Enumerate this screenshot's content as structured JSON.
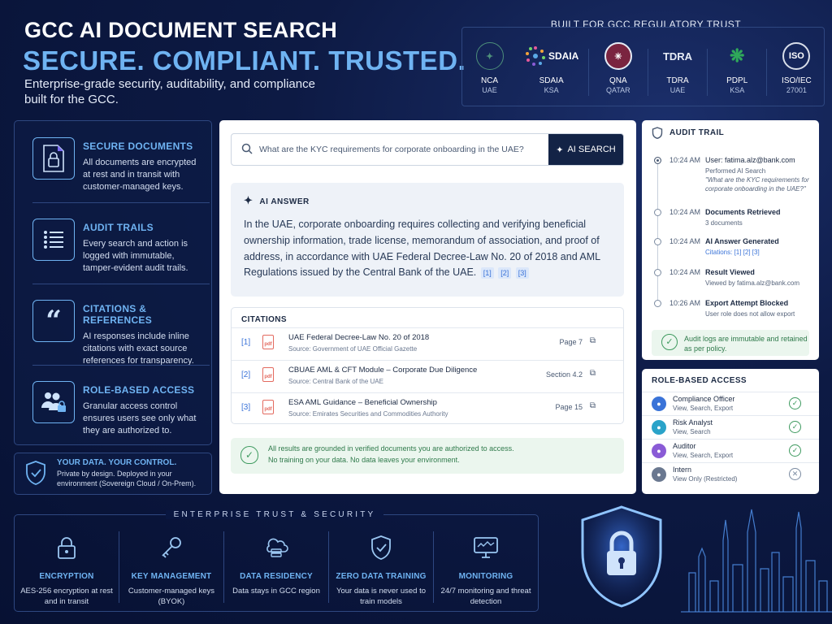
{
  "hero": {
    "title": "GCC AI DOCUMENT SEARCH",
    "subtitle": "SECURE. COMPLIANT. TRUSTED.",
    "description": "Enterprise-grade security, auditability, and compliance built for the GCC."
  },
  "trust": {
    "heading": "BUILT FOR GCC REGULATORY TRUST",
    "badges": [
      {
        "name": "NCA",
        "sub": "UAE",
        "logo_text": "",
        "color": "#4d8f7a"
      },
      {
        "name": "SDAIA",
        "sub": "KSA",
        "logo_text": "SDAIA",
        "color": "#5aa9e6"
      },
      {
        "name": "QNA",
        "sub": "QATAR",
        "logo_text": "",
        "color": "#7a2440"
      },
      {
        "name": "TDRA",
        "sub": "UAE",
        "logo_text": "TDRA",
        "color": "#e6ecf6"
      },
      {
        "name": "PDPL",
        "sub": "KSA",
        "logo_text": "",
        "color": "#2fa85a"
      },
      {
        "name": "ISO/IEC",
        "sub": "27001",
        "logo_text": "ISO",
        "color": "#d8dee9"
      }
    ]
  },
  "features": [
    {
      "icon": "secure-document-icon",
      "title": "SECURE DOCUMENTS",
      "desc": "All documents are encrypted at rest and in transit with customer-managed keys."
    },
    {
      "icon": "audit-list-icon",
      "title": "AUDIT TRAILS",
      "desc": "Every search and action is logged with immutable, tamper-evident audit trails."
    },
    {
      "icon": "quote-icon",
      "title": "CITATIONS & REFERENCES",
      "desc": "AI responses include inline citations with exact source references for transparency."
    },
    {
      "icon": "users-lock-icon",
      "title": "ROLE-BASED ACCESS",
      "desc": "Granular access control ensures users see only what they are authorized to."
    }
  ],
  "control": {
    "title": "YOUR DATA. YOUR CONTROL.",
    "desc": "Private by design. Deployed in your environment (Sovereign Cloud / On-Prem)."
  },
  "search": {
    "value": "What are the KYC requirements for corporate onboarding in the UAE?",
    "button": "AI SEARCH"
  },
  "answer": {
    "heading": "AI ANSWER",
    "text": "In the UAE, corporate onboarding requires collecting and verifying beneficial ownership information, trade license, memorandum of association, and proof of address, in accordance with UAE Federal Decree-Law No. 20 of 2018 and AML Regulations issued by the Central Bank of the UAE.",
    "refs": [
      "[1]",
      "[2]",
      "[3]"
    ]
  },
  "citations": {
    "heading": "CITATIONS",
    "items": [
      {
        "num": "[1]",
        "title": "UAE Federal Decree-Law No. 20 of 2018",
        "source": "Source: Government of UAE Official Gazette",
        "page": "Page 7"
      },
      {
        "num": "[2]",
        "title": "CBUAE AML & CFT Module – Corporate Due Diligence",
        "source": "Source: Central Bank of the UAE",
        "page": "Section 4.2"
      },
      {
        "num": "[3]",
        "title": "ESA AML Guidance – Beneficial Ownership",
        "source": "Source: Emirates Securities and Commodities Authority",
        "page": "Page 15"
      }
    ],
    "pdf_label": "pdf"
  },
  "grounded": {
    "line1": "All results are grounded in verified documents you are authorized to access.",
    "line2": "No training on your data. No data leaves your environment."
  },
  "audit": {
    "heading": "AUDIT TRAIL",
    "events": [
      {
        "time": "10:24 AM",
        "title": "User: fatima.alz@bank.com",
        "d1": "Performed AI Search",
        "d2": "\"What are the KYC requirements for corporate onboarding in the UAE?\""
      },
      {
        "time": "10:24 AM",
        "title": "Documents Retrieved",
        "d1": "3 documents",
        "d2": ""
      },
      {
        "time": "10:24 AM",
        "title": "AI Answer Generated",
        "d1": "Citations: [1] [2] [3]",
        "d2": ""
      },
      {
        "time": "10:24 AM",
        "title": "Result Viewed",
        "d1": "Viewed by fatima.alz@bank.com",
        "d2": ""
      },
      {
        "time": "10:26 AM",
        "title": "Export Attempt Blocked",
        "d1": "User role does not allow export",
        "d2": ""
      }
    ],
    "note": "Audit logs are immutable and retained as per policy."
  },
  "roles": {
    "heading": "ROLE-BASED ACCESS",
    "items": [
      {
        "name": "Compliance Officer",
        "perms": "View, Search, Export",
        "allowed": true,
        "color": "#3a73d8"
      },
      {
        "name": "Risk Analyst",
        "perms": "View, Search",
        "allowed": true,
        "color": "#2aa3c9"
      },
      {
        "name": "Auditor",
        "perms": "View, Search, Export",
        "allowed": true,
        "color": "#8a5bd6"
      },
      {
        "name": "Intern",
        "perms": "View Only (Restricted)",
        "allowed": false,
        "color": "#6a7890"
      }
    ]
  },
  "enterprise": {
    "heading": "ENTERPRISE TRUST & SECURITY",
    "tiles": [
      {
        "icon": "padlock-icon",
        "title": "ENCRYPTION",
        "desc": "AES-256 encryption at rest and in transit"
      },
      {
        "icon": "key-icon",
        "title": "KEY MANAGEMENT",
        "desc": "Customer-managed keys (BYOK)"
      },
      {
        "icon": "cloud-database-icon",
        "title": "DATA RESIDENCY",
        "desc": "Data stays in GCC region"
      },
      {
        "icon": "shield-check-icon",
        "title": "ZERO DATA TRAINING",
        "desc": "Your data is never used to train models"
      },
      {
        "icon": "monitor-icon",
        "title": "MONITORING",
        "desc": "24/7 monitoring and threat detection"
      }
    ]
  }
}
